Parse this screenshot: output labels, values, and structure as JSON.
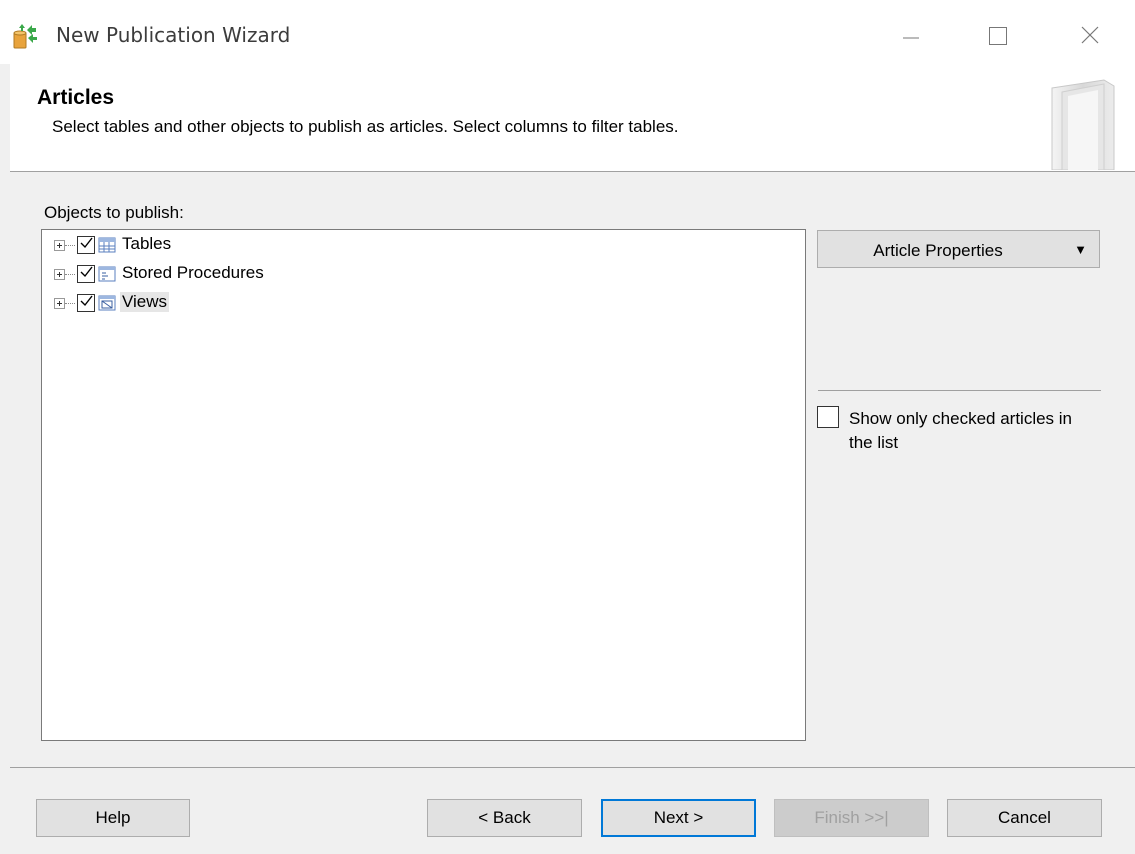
{
  "window": {
    "title": "New Publication Wizard",
    "controls": [
      "minimize-icon",
      "maximize-icon",
      "close-icon"
    ]
  },
  "header": {
    "title": "Articles",
    "description": "Select tables and other objects to publish as articles. Select columns to filter tables."
  },
  "objects": {
    "label": "Objects to publish:",
    "items": [
      {
        "label": "Tables",
        "checked": true,
        "icon": "table-icon"
      },
      {
        "label": "Stored Procedures",
        "checked": true,
        "icon": "stored-procedure-icon"
      },
      {
        "label": "Views",
        "checked": true,
        "icon": "view-icon",
        "selected": true
      }
    ]
  },
  "article_properties": {
    "label": "Article Properties",
    "arrow": "▼"
  },
  "show_only_checked": {
    "label": "Show only checked articles in the list",
    "checked": false
  },
  "footer": {
    "help": "Help",
    "back": "< Back",
    "next": "Next >",
    "finish": "Finish >>|",
    "cancel": "Cancel"
  },
  "colors": {
    "accent": "#0078d7",
    "dialog_bg": "#f0f0f0",
    "button_bg": "#e1e1e1"
  }
}
